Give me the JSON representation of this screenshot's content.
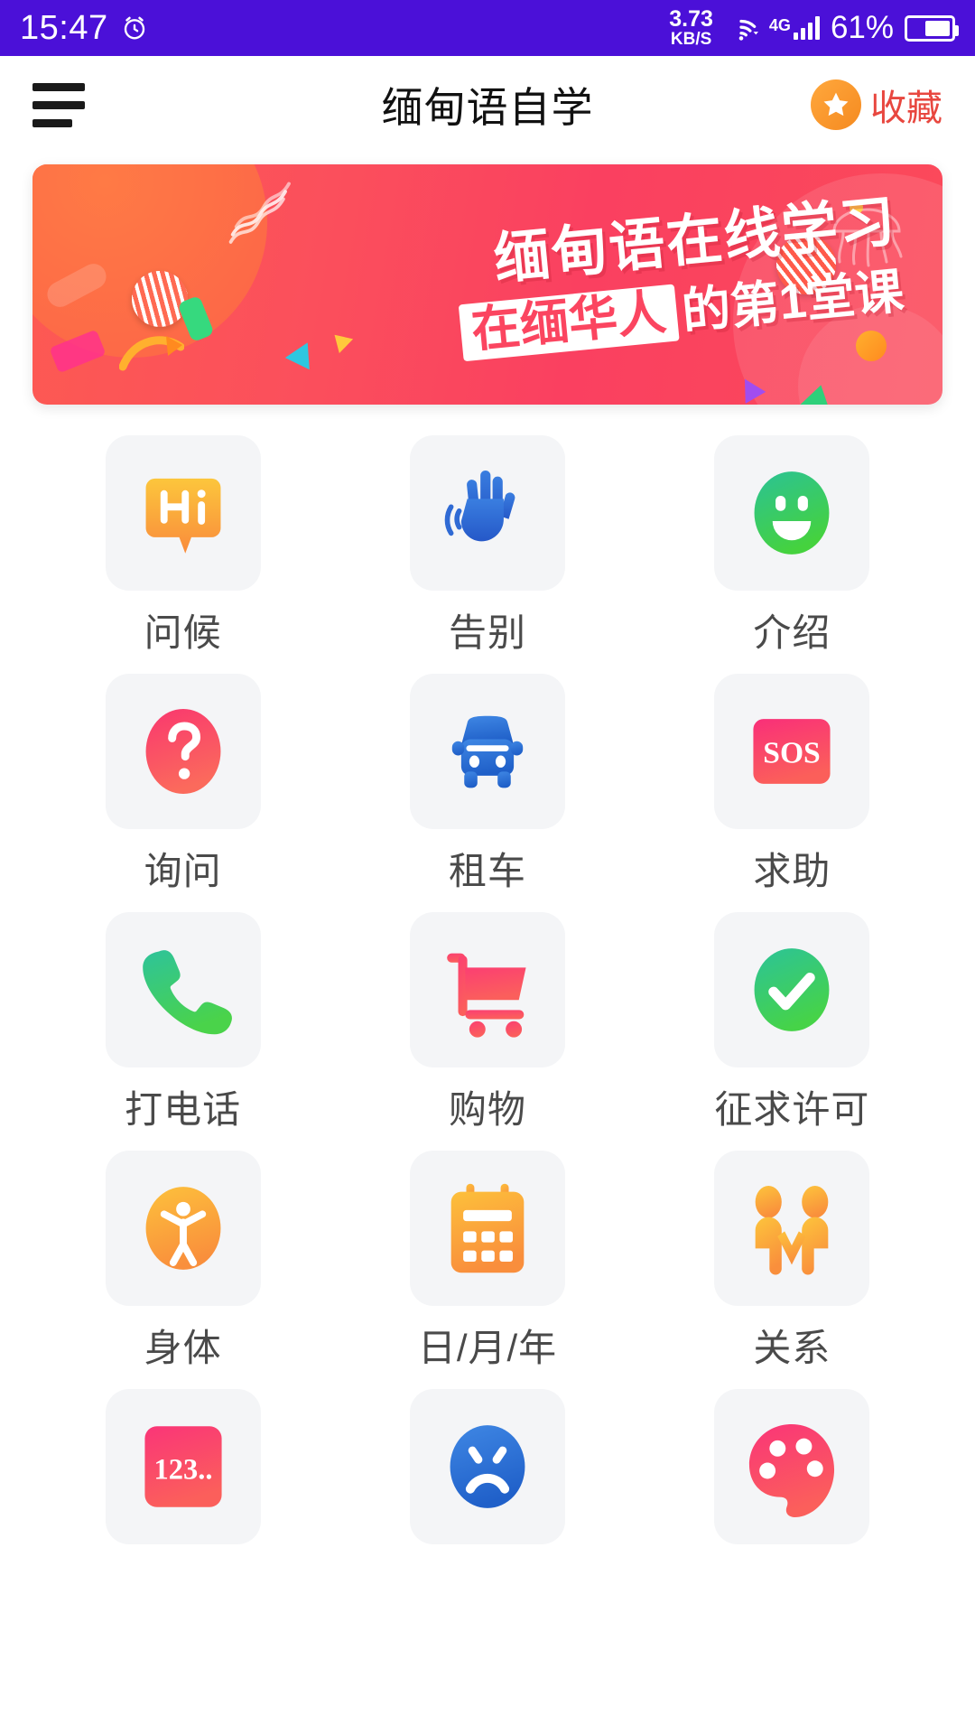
{
  "status_bar": {
    "time": "15:47",
    "alarm_icon": "alarm-clock-icon",
    "network_speed_value": "3.73",
    "network_speed_unit": "KB/S",
    "wifi_icon": "wifi-icon",
    "mobile_network": "4G",
    "signal_icon": "signal-bars-icon",
    "battery_percent": "61%",
    "battery_icon": "battery-icon",
    "background_color": "#4b10d8"
  },
  "app_bar": {
    "menu_icon": "hamburger-menu-icon",
    "title": "缅甸语自学",
    "favorite": {
      "icon": "star-icon",
      "label": "收藏",
      "label_color": "#e8473f",
      "badge_color": "#f79421"
    }
  },
  "banner": {
    "line1": "缅甸语在线学习",
    "line2_highlight": "在缅华人",
    "line2_rest": "的第1堂课",
    "background_color": "#fb4560",
    "accent_color": "#ff7a45"
  },
  "grid": {
    "items": [
      {
        "label": "问候",
        "icon": "hi-speech-bubble-icon",
        "color": "#f9a03c"
      },
      {
        "label": "告别",
        "icon": "waving-hand-icon",
        "color": "#2f6fd0"
      },
      {
        "label": "介绍",
        "icon": "smiley-face-icon",
        "color": "#30c878"
      },
      {
        "label": "询问",
        "icon": "question-mark-icon",
        "color": "#fa4a6e"
      },
      {
        "label": "租车",
        "icon": "car-icon",
        "color": "#2f7ad6"
      },
      {
        "label": "求助",
        "icon": "sos-icon",
        "color": "#fa3f6e"
      },
      {
        "label": "打电话",
        "icon": "phone-call-icon",
        "color": "#2fc98a"
      },
      {
        "label": "购物",
        "icon": "shopping-cart-icon",
        "color": "#fb4a68"
      },
      {
        "label": "征求许可",
        "icon": "check-circle-icon",
        "color": "#35c888"
      },
      {
        "label": "身体",
        "icon": "body-person-icon",
        "color": "#fdb03c"
      },
      {
        "label": "日/月/年",
        "icon": "calendar-icon",
        "color": "#fdaf3b"
      },
      {
        "label": "关系",
        "icon": "handshake-people-icon",
        "color": "#fdb63f"
      },
      {
        "label": "",
        "icon": "numbers-123-icon",
        "color": "#fb3f68"
      },
      {
        "label": "",
        "icon": "sad-face-icon",
        "color": "#2f7ad6"
      },
      {
        "label": "",
        "icon": "paint-palette-icon",
        "color": "#fb3f68"
      }
    ]
  }
}
